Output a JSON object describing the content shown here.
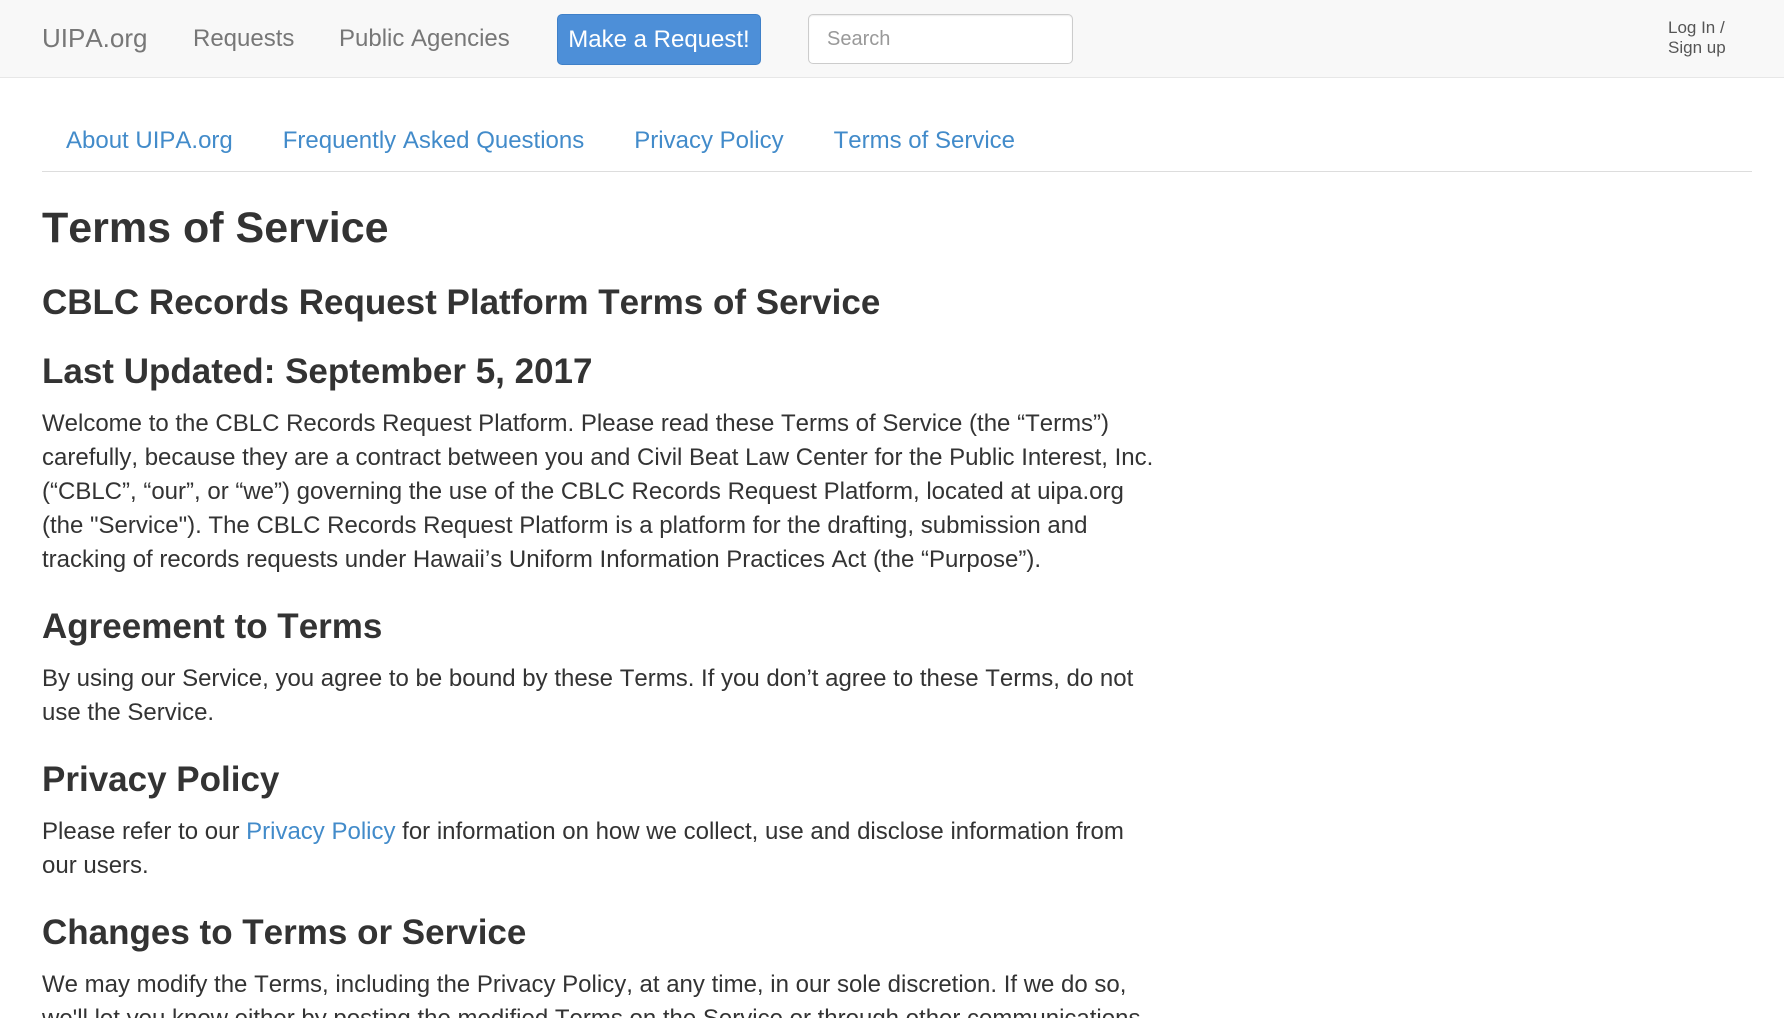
{
  "navbar": {
    "brand": "UIPA.org",
    "links": [
      {
        "label": "Requests"
      },
      {
        "label": "Public Agencies"
      }
    ],
    "cta_label": "Make a Request!",
    "search_placeholder": "Search",
    "account_label": "Log In / Sign up"
  },
  "subnav": {
    "tabs": [
      {
        "label": "About UIPA.org"
      },
      {
        "label": "Frequently Asked Questions"
      },
      {
        "label": "Privacy Policy"
      },
      {
        "label": "Terms of Service"
      }
    ]
  },
  "content": {
    "title": "Terms of Service",
    "subtitle": "CBLC Records Request Platform Terms of Service",
    "last_updated": "Last Updated: September 5, 2017",
    "intro": "Welcome to the CBLC Records Request Platform. Please read these Terms of Service (the “Terms”) carefully, because they are a contract between you and Civil Beat Law Center for the Public Interest, Inc. (“CBLC”, “our”, or “we”) governing the use of the CBLC Records Request Platform, located at uipa.org (the \"Service\"). The CBLC Records Request Platform is a platform for the drafting, submission and tracking of records requests under Hawaii’s Uniform Information Practices Act (the “Purpose”).",
    "agreement": {
      "heading": "Agreement to Terms",
      "body": "By using our Service, you agree to be bound by these Terms. If you don’t agree to these Terms, do not use the Service."
    },
    "privacy": {
      "heading": "Privacy Policy",
      "body_before": "Please refer to our ",
      "link_label": "Privacy Policy",
      "body_after": " for information on how we collect, use and disclose information from our users."
    },
    "changes": {
      "heading": "Changes to Terms or Service",
      "body": "We may modify the Terms, including the Privacy Policy, at any time, in our sole discretion. If we do so, we'll let you know either by posting the modified Terms on the Service or through other communications"
    }
  },
  "colors": {
    "navbar_bg": "#f8f8f8",
    "navbar_border": "#e7e7e7",
    "nav_text": "#777777",
    "button": "#4d8fd8",
    "button_border": "#3f80c8",
    "link": "#428bca",
    "text": "#333333"
  }
}
